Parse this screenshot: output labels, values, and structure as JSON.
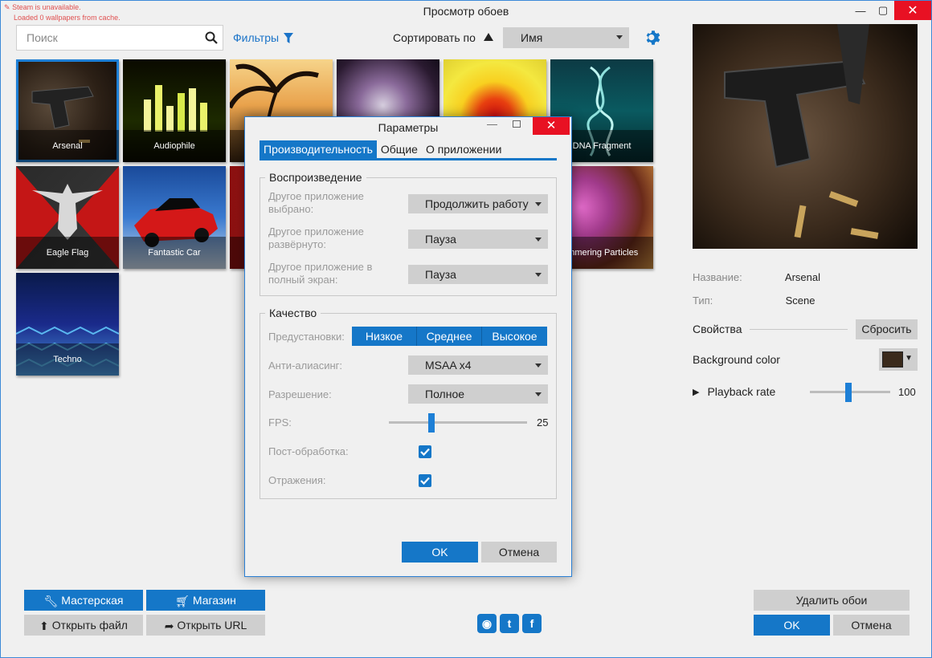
{
  "window": {
    "title": "Просмотр обоев",
    "status_lines": [
      "Steam is unavailable.",
      "Loaded 0 wallpapers from cache."
    ]
  },
  "toolbar": {
    "search_placeholder": "Поиск",
    "filters_label": "Фильтры",
    "sort_label": "Сортировать по",
    "sort_value": "Имя"
  },
  "wallpapers": [
    {
      "name": "Arsenal",
      "selected": true
    },
    {
      "name": "Audiophile"
    },
    {
      "name": ""
    },
    {
      "name": ""
    },
    {
      "name": ""
    },
    {
      "name": "DNA Fragment"
    },
    {
      "name": "Eagle Flag"
    },
    {
      "name": "Fantastic Car"
    },
    {
      "name": ""
    },
    {
      "name": ""
    },
    {
      "name": ""
    },
    {
      "name": "immering Particles"
    },
    {
      "name": "Techno"
    }
  ],
  "details": {
    "name_label": "Название:",
    "name_value": "Arsenal",
    "type_label": "Тип:",
    "type_value": "Scene",
    "properties_label": "Свойства",
    "reset_label": "Сбросить",
    "bg_color_label": "Background color",
    "bg_color": "#3a2a1c",
    "playback_label": "Playback rate",
    "playback_value": "100",
    "playback_fraction": 0.48
  },
  "bottom": {
    "workshop": "Мастерская",
    "shop": "Магазин",
    "open_file": "Открыть файл",
    "open_url": "Открыть URL",
    "delete": "Удалить обои",
    "ok": "OK",
    "cancel": "Отмена"
  },
  "dialog": {
    "title": "Параметры",
    "tabs": [
      "Производительность",
      "Общие",
      "О приложении"
    ],
    "playback_group": "Воспроизведение",
    "other_selected_label": [
      "Другое приложение",
      "выбрано:"
    ],
    "other_selected_value": "Продолжить работу",
    "other_maximized_label": [
      "Другое приложение",
      "развёрнуто:"
    ],
    "other_maximized_value": "Пауза",
    "other_fullscreen_label": [
      "Другое приложение в",
      "полный экран:"
    ],
    "other_fullscreen_value": "Пауза",
    "quality_group": "Качество",
    "presets_label": "Предустановки:",
    "presets": [
      "Низкое",
      "Среднее",
      "Высокое"
    ],
    "aa_label": "Анти-алиасинг:",
    "aa_value": "MSAA x4",
    "resolution_label": "Разрешение:",
    "resolution_value": "Полное",
    "fps_label": "FPS:",
    "fps_value": "25",
    "postprocess_label": "Пост-обработка:",
    "postprocess_checked": true,
    "reflections_label": "Отражения:",
    "reflections_checked": true,
    "ok": "OK",
    "cancel": "Отмена"
  },
  "colors": {
    "accent": "#1577c8",
    "close_red": "#e81123"
  }
}
